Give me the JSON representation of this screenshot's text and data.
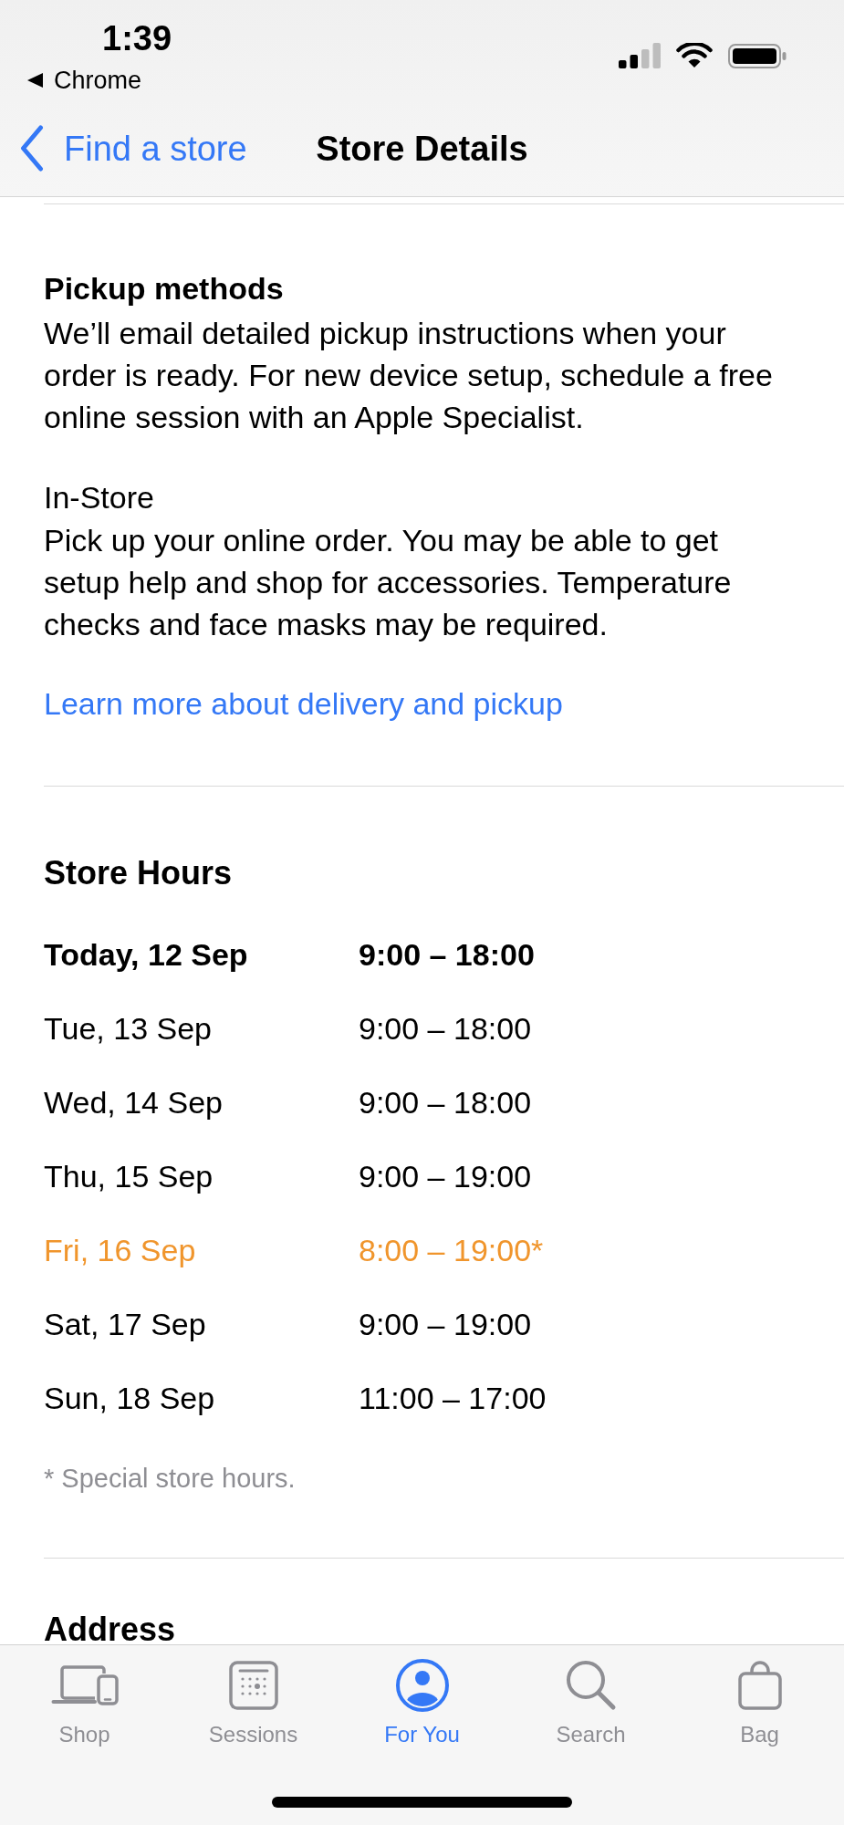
{
  "status_bar": {
    "time": "1:39",
    "back_app": "Chrome"
  },
  "nav_bar": {
    "back_label": "Find a store",
    "title": "Store Details"
  },
  "pickup": {
    "heading": "Pickup methods",
    "intro": "We’ll email detailed pickup instructions when your order is ready. For new device setup, schedule a free online session with an Apple Specialist.",
    "methods": [
      {
        "title": "In-Store",
        "text": "Pick up your online order. You may be able to get setup help and shop for accessories. Temperature checks and face masks may be required."
      }
    ],
    "link": "Learn more about delivery and pickup"
  },
  "store_hours": {
    "heading": "Store Hours",
    "rows": [
      {
        "kind": "today",
        "day": "Today, 12 Sep",
        "hours": "9:00 – 18:00"
      },
      {
        "kind": "regular",
        "day": "Tue, 13 Sep",
        "hours": "9:00 – 18:00"
      },
      {
        "kind": "regular",
        "day": "Wed, 14 Sep",
        "hours": "9:00 – 18:00"
      },
      {
        "kind": "regular",
        "day": "Thu, 15 Sep",
        "hours": "9:00 – 19:00"
      },
      {
        "kind": "special",
        "day": "Fri, 16 Sep",
        "hours": "8:00 – 19:00*"
      },
      {
        "kind": "regular",
        "day": "Sat, 17 Sep",
        "hours": "9:00 – 19:00"
      },
      {
        "kind": "regular",
        "day": "Sun, 18 Sep",
        "hours": "11:00 – 17:00"
      }
    ],
    "footnote": "* Special store hours."
  },
  "address": {
    "heading": "Address"
  },
  "tab_bar": {
    "tabs": [
      {
        "kind": "shop",
        "label": "Shop",
        "selected": false
      },
      {
        "kind": "sessions",
        "label": "Sessions",
        "selected": false
      },
      {
        "kind": "account",
        "label": "For You",
        "selected": true
      },
      {
        "kind": "search",
        "label": "Search",
        "selected": false
      },
      {
        "kind": "bag",
        "label": "Bag",
        "selected": false
      }
    ]
  }
}
